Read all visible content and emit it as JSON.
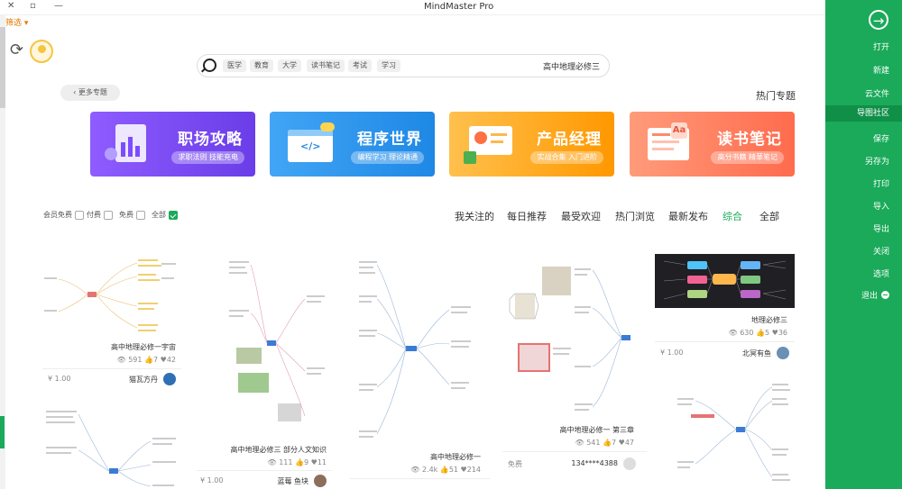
{
  "window": {
    "title": "MindMaster Pro"
  },
  "menu": {
    "filter_label": "筛选 ▾"
  },
  "sidebar": {
    "items": [
      "打开",
      "新建",
      "云文件",
      "导图社区",
      "保存",
      "另存为",
      "打印",
      "导入",
      "导出",
      "关闭",
      "选项"
    ],
    "active_index": 3,
    "exit_label": "退出"
  },
  "search": {
    "placeholder": "高中地理必修三",
    "tags": [
      "学习",
      "考试",
      "读书笔记",
      "大学",
      "教育",
      "医学"
    ]
  },
  "hot": {
    "title": "热门专题",
    "more_label": "更多专题"
  },
  "banners": [
    {
      "title": "读书笔记",
      "sub": "高分书籍 精華笔记",
      "color": "#ff7a5c"
    },
    {
      "title": "产品经理",
      "sub": "实战合集 入门进阶",
      "color": "#ffa726"
    },
    {
      "title": "程序世界",
      "sub": "编程学习 理论精通",
      "color": "#2196f3"
    },
    {
      "title": "职场攻略",
      "sub": "求职法则 技能充电",
      "color": "#7c4dff"
    }
  ],
  "categories": [
    "全部",
    "综合",
    "最新发布",
    "热门浏览",
    "最受欢迎",
    "每日推荐",
    "我关注的"
  ],
  "active_category": 1,
  "filters": [
    {
      "label": "全部",
      "checked": true
    },
    {
      "label": "免费",
      "checked": false
    },
    {
      "label": "付费",
      "checked": false
    },
    {
      "label": "会员免费",
      "checked": false
    }
  ],
  "cards": [
    {
      "title": "地理必修三",
      "views": "630",
      "likes": "5",
      "hearts": "36",
      "author": "北冥有鱼",
      "price": "¥ 1.00"
    },
    {
      "title": "高中地理必修一 第三章",
      "views": "541",
      "likes": "7",
      "hearts": "47",
      "author": "134****4388",
      "price": "免费"
    },
    {
      "title": "高中地理必修一",
      "views": "2.4k",
      "likes": "51",
      "hearts": "214",
      "author": "",
      "price": ""
    },
    {
      "title": "高中地理必修三 部分人文知识",
      "views": "111",
      "likes": "9",
      "hearts": "11",
      "author": "蓝莓 鱼块",
      "price": "¥ 1.00"
    },
    {
      "title": "高中地理必修一宇宙",
      "views": "591",
      "likes": "7",
      "hearts": "42",
      "author": "猫瓦方丹",
      "price": "¥ 1.00"
    }
  ],
  "colors": {
    "accent": "#1aaa5a",
    "sidebar_active": "#0f8f47"
  }
}
